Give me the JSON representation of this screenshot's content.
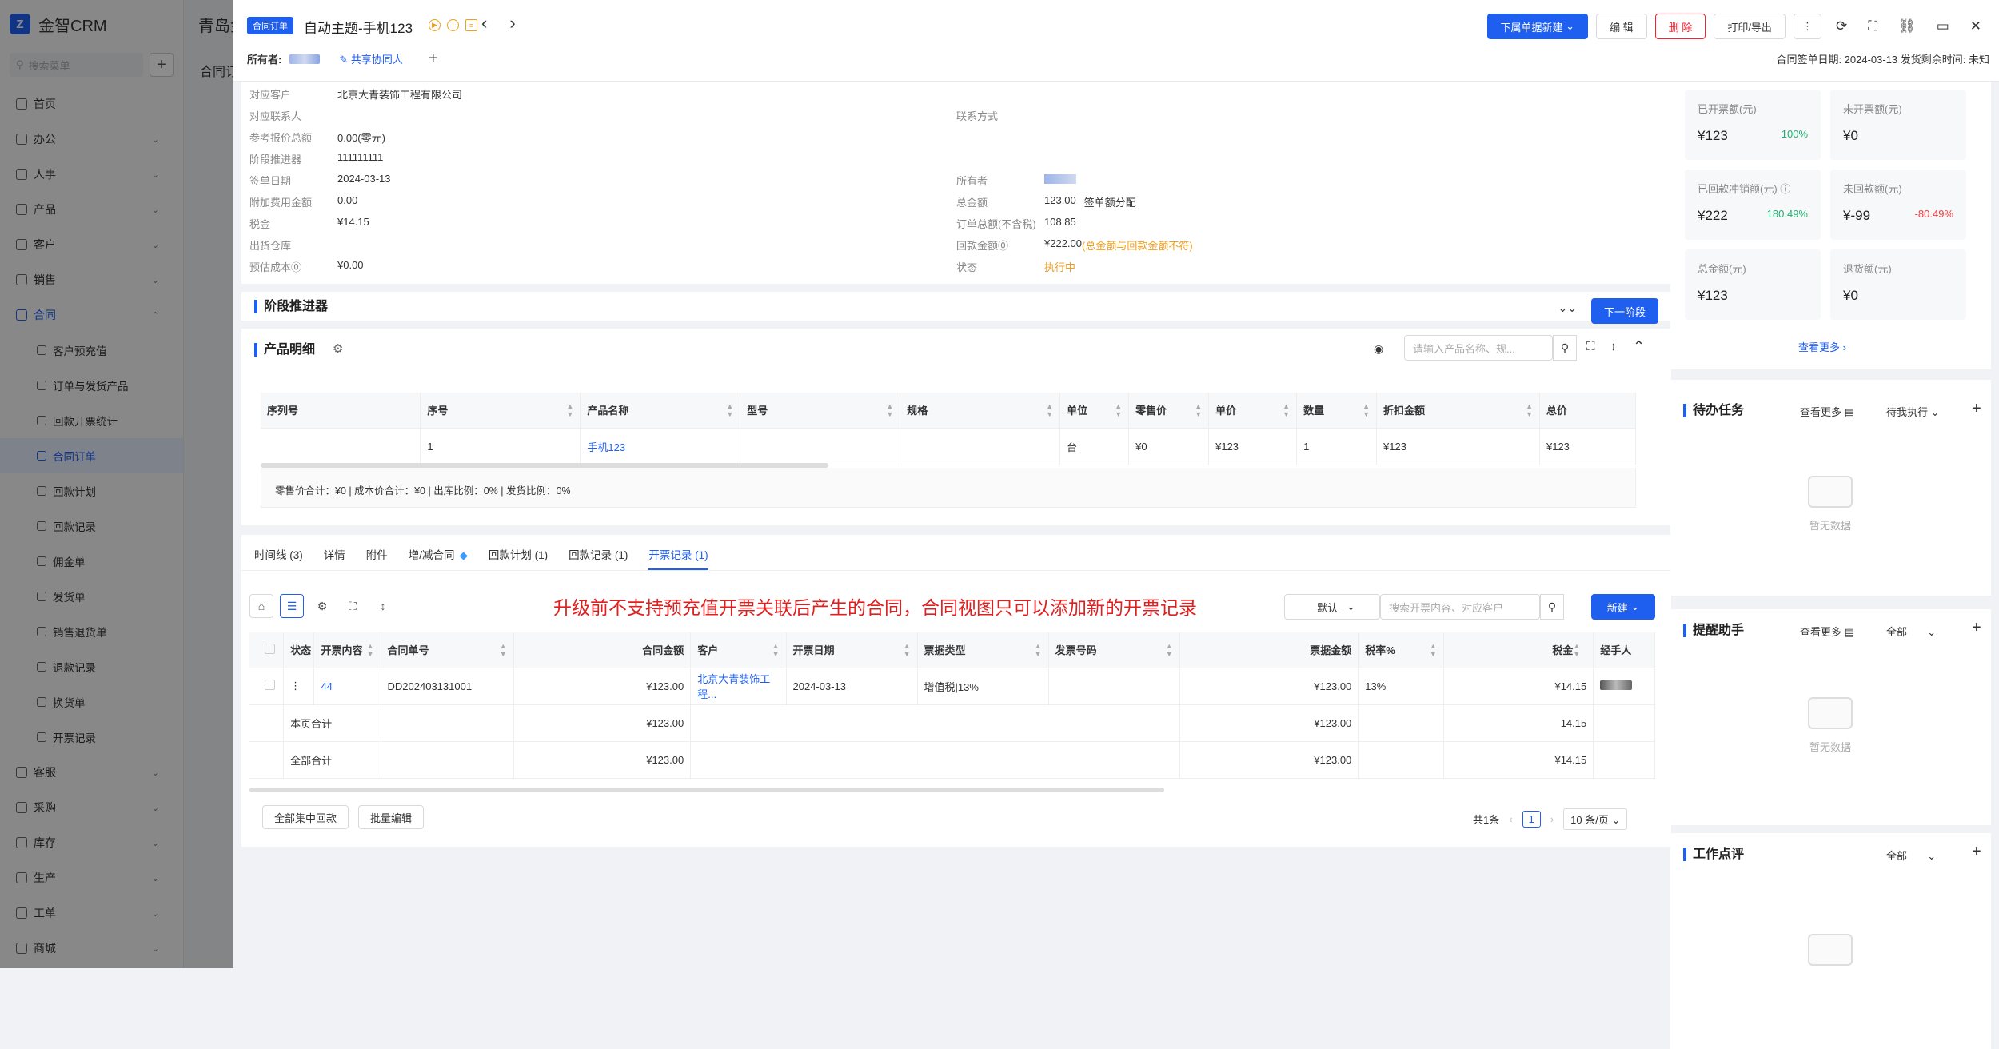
{
  "sidebar": {
    "logo": "金智CRM",
    "search_placeholder": "搜索菜单",
    "items": [
      {
        "label": "首页",
        "chev": ""
      },
      {
        "label": "办公",
        "chev": "⌄"
      },
      {
        "label": "人事",
        "chev": "⌄"
      },
      {
        "label": "产品",
        "chev": "⌄"
      },
      {
        "label": "客户",
        "chev": "⌄"
      },
      {
        "label": "销售",
        "chev": "⌄"
      },
      {
        "label": "合同",
        "chev": "⌃"
      }
    ],
    "sub_items": [
      "客户预充值",
      "订单与发货产品",
      "回款开票统计",
      "合同订单",
      "回款计划",
      "回款记录",
      "佣金单",
      "发货单",
      "销售退货单",
      "退款记录",
      "换货单",
      "开票记录"
    ],
    "items_bottom": [
      {
        "label": "客服",
        "chev": "⌄"
      },
      {
        "label": "采购",
        "chev": "⌄"
      },
      {
        "label": "库存",
        "chev": "⌄"
      },
      {
        "label": "生产",
        "chev": "⌄"
      },
      {
        "label": "工单",
        "chev": "⌄"
      },
      {
        "label": "商城",
        "chev": "⌄"
      }
    ]
  },
  "background": {
    "tab": "青岛金",
    "tab2": "合同订"
  },
  "header": {
    "badge": "合同订单",
    "title": "自动主题-手机123",
    "owner_label": "所有者:",
    "share_label": "共享协同人",
    "add_icon": "+",
    "buttons": {
      "new_order": "下属单据新建",
      "edit": "编 辑",
      "delete": "删 除",
      "print": "打印/导出"
    },
    "dates": "合同签单日期:  2024-03-13  发货剩余时间:  未知"
  },
  "info": {
    "rows_left": [
      {
        "k": "对应客户",
        "v": "北京大青装饰工程有限公司",
        "link": true
      },
      {
        "k": "对应联系人",
        "v": ""
      },
      {
        "k": "参考报价总额",
        "v": "0.00(零元)"
      },
      {
        "k": "阶段推进器",
        "v": "111111111"
      },
      {
        "k": "签单日期",
        "v": "2024-03-13"
      },
      {
        "k": "附加费用金额",
        "v": "0.00"
      },
      {
        "k": "税金",
        "v": "¥14.15"
      },
      {
        "k": "出货仓库",
        "v": ""
      },
      {
        "k": "预估成本⓪",
        "v": "¥0.00"
      }
    ],
    "rows_right": [
      {
        "k": "联系方式",
        "v": ""
      },
      {
        "k": "所有者",
        "v": ""
      },
      {
        "k": "总金额",
        "v": "123.00"
      },
      {
        "k": "订单总额(不含税)",
        "v": "108.85"
      },
      {
        "k": "回款金额⓪",
        "v": "¥222.00"
      },
      {
        "k": "状态",
        "v": "执行中"
      }
    ],
    "sign_split": "签单额分配",
    "refund_warn": "(总金额与回款金额不符)"
  },
  "stage": {
    "title": "阶段推进器",
    "next": "下一阶段"
  },
  "products": {
    "title": "产品明细",
    "search_placeholder": "请输入产品名称、规...",
    "columns": [
      "序列号",
      "序号",
      "产品名称",
      "型号",
      "规格",
      "单位",
      "零售价",
      "单价",
      "数量",
      "折扣金额",
      "总价"
    ],
    "rows": [
      [
        "",
        "1",
        "手机123",
        "",
        "",
        "台",
        "¥0",
        "¥123",
        "1",
        "¥123",
        "¥123"
      ]
    ],
    "summary": "零售价合计：¥0 |   成本价合计：¥0 |   出库比例：0% |   发货比例：0%"
  },
  "tabs": {
    "items": [
      "时间线 (3)",
      "详情",
      "附件",
      "增/减合同",
      "回款计划 (1)",
      "回款记录 (1)",
      "开票记录 (1)"
    ],
    "note": "升级前不支持预充值开票关联后产生的合同，合同视图只可以添加新的开票记录",
    "filter_default": "默认",
    "search_placeholder": "搜索开票内容、对应客户",
    "new_btn": "新建",
    "columns": [
      "状态",
      "开票内容",
      "合同单号",
      "合同金额",
      "客户",
      "开票日期",
      "票据类型",
      "发票号码",
      "票据金额",
      "税率%",
      "税金",
      "经手人"
    ],
    "row": {
      "dots": "⋮",
      "content": "44",
      "order_no": "DD202403131001",
      "amount": "¥123.00",
      "customer": "北京大青装饰工程...",
      "date": "2024-03-13",
      "type": "增值税|13%",
      "invoice_no": "",
      "invoice_amount": "¥123.00",
      "rate": "13%",
      "tax": "¥14.15"
    },
    "page_total": {
      "label": "本页合计",
      "amount": "¥123.00",
      "invoice_amount": "¥123.00",
      "tax": "14.15"
    },
    "all_total": {
      "label": "全部合计",
      "amount": "¥123.00",
      "invoice_amount": "¥123.00",
      "tax": "¥14.15"
    },
    "bottom_btns": [
      "全部集中回款",
      "批量编辑"
    ],
    "pagination": {
      "total": "共1条",
      "page": "1",
      "size": "10 条/页"
    }
  },
  "stats": [
    {
      "label": "已开票额(元)",
      "value": "¥123",
      "pct": "100%",
      "pct_color": "#20b070"
    },
    {
      "label": "未开票额(元)",
      "value": "¥0",
      "pct": "",
      "pct_color": ""
    },
    {
      "label": "已回款冲销额(元) ⓘ",
      "value": "¥222",
      "pct": "180.49%",
      "pct_color": "#20b070"
    },
    {
      "label": "未回款额(元)",
      "value": "¥-99",
      "pct": "-80.49%",
      "pct_color": "#f04040"
    },
    {
      "label": "总金额(元)",
      "value": "¥123",
      "pct": "",
      "pct_color": ""
    },
    {
      "label": "退货额(元)",
      "value": "¥0",
      "pct": "",
      "pct_color": ""
    }
  ],
  "more": "查看更多",
  "todo": {
    "title": "待办任务",
    "more": "查看更多",
    "filter": "待我执行",
    "empty": "暂无数据"
  },
  "reminder": {
    "title": "提醒助手",
    "more": "查看更多",
    "filter": "全部",
    "empty": "暂无数据"
  },
  "review": {
    "title": "工作点评",
    "filter": "全部"
  }
}
